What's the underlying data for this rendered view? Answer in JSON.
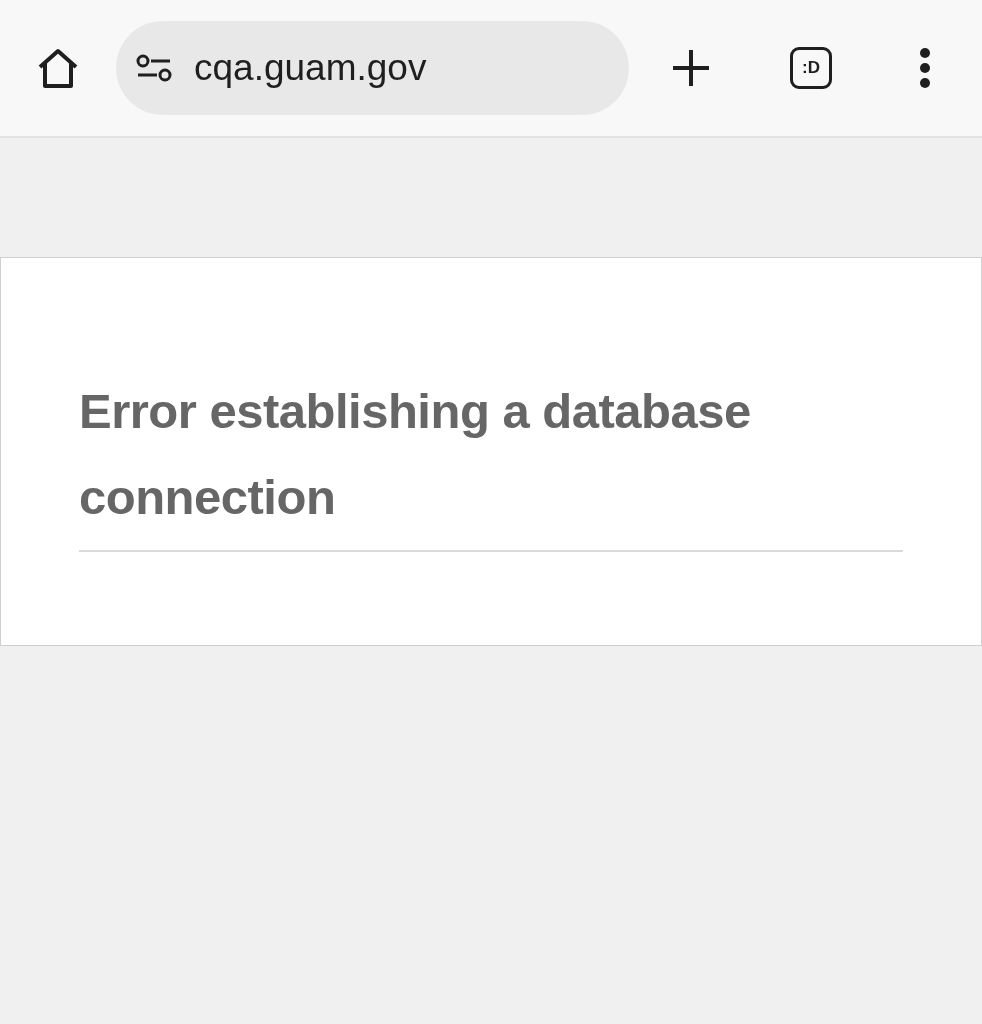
{
  "toolbar": {
    "address": "cqa.guam.gov",
    "tab_switcher": ":D"
  },
  "error": {
    "heading": "Error establishing a database connection"
  }
}
